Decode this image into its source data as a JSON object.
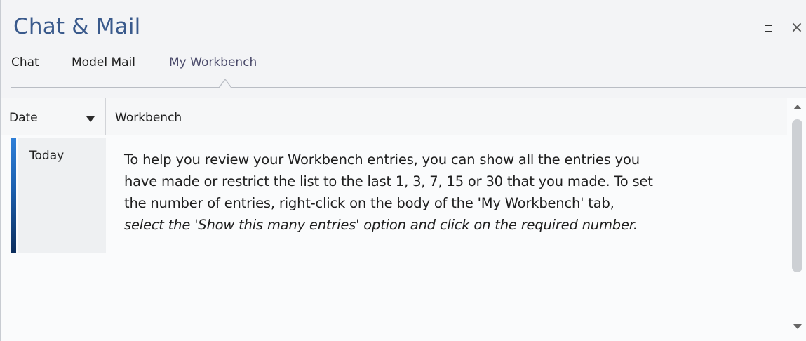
{
  "window": {
    "title": "Chat & Mail",
    "maximize_icon": "maximize-icon",
    "close_icon": "close-icon",
    "close_glyph": "×"
  },
  "tabs": [
    {
      "label": "Chat",
      "active": false
    },
    {
      "label": "Model Mail",
      "active": false
    },
    {
      "label": "My Workbench",
      "active": true
    }
  ],
  "list": {
    "columns": [
      {
        "label": "Date",
        "sort_icon": "sort-descending-icon"
      },
      {
        "label": "Workbench"
      }
    ],
    "entries": [
      {
        "date": "Today",
        "text_lines": [
          "To help you review your Workbench entries, you can show all the entries you",
          "have made or restrict the list to the last 1, 3, 7, 15 or 30 that you made. To set",
          "the number of entries, right-click on the body of the 'My Workbench' tab,"
        ],
        "text_italic_line": "select the 'Show this many entries' option and click on the required number.",
        "accent_color": "#1b5fae"
      }
    ]
  },
  "scrollbar": {
    "up_icon": "scroll-up-icon",
    "down_icon": "scroll-down-icon"
  }
}
